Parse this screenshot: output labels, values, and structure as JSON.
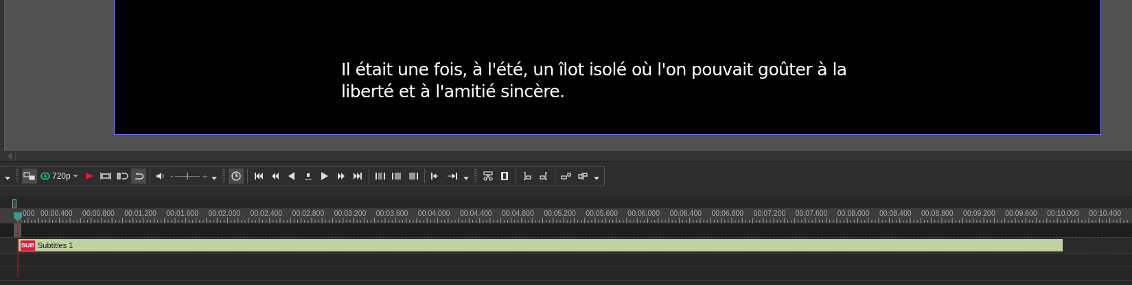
{
  "preview": {
    "subtitle_lines": [
      "Il était une fois, à l'été, un îlot isolé où l'on pouvait goûter à la",
      "liberté et à l'amitié sincère."
    ]
  },
  "toolbar": [
    {
      "kind": "caret"
    },
    {
      "kind": "grip"
    },
    {
      "kind": "monitor",
      "on": true
    },
    {
      "kind": "resolution",
      "label": "720p"
    },
    {
      "kind": "preview-play",
      "on": false
    },
    {
      "kind": "range",
      "on": false
    },
    {
      "kind": "loop-in",
      "on": false
    },
    {
      "kind": "loop",
      "on": true
    },
    {
      "kind": "sep"
    },
    {
      "kind": "speaker",
      "on": false
    },
    {
      "kind": "volume",
      "minus": "-",
      "plus": "+",
      "level": 0.5
    },
    {
      "kind": "caret"
    },
    {
      "kind": "grip"
    },
    {
      "kind": "clock",
      "on": true
    },
    {
      "kind": "sep"
    },
    {
      "kind": "skip-start",
      "on": false
    },
    {
      "kind": "rewind",
      "on": false
    },
    {
      "kind": "step-back",
      "on": false
    },
    {
      "kind": "marker",
      "on": false
    },
    {
      "kind": "play",
      "on": false
    },
    {
      "kind": "forward",
      "on": false
    },
    {
      "kind": "skip-end",
      "on": false
    },
    {
      "kind": "sep"
    },
    {
      "kind": "fade-both",
      "on": false
    },
    {
      "kind": "fade-in",
      "on": false
    },
    {
      "kind": "fade-out",
      "on": false
    },
    {
      "kind": "sep"
    },
    {
      "kind": "go-in",
      "on": false
    },
    {
      "kind": "go-out",
      "on": false
    },
    {
      "kind": "caret"
    },
    {
      "kind": "grip"
    },
    {
      "kind": "scissors",
      "on": false
    },
    {
      "kind": "split",
      "on": false
    },
    {
      "kind": "sep"
    },
    {
      "kind": "align-left",
      "on": false
    },
    {
      "kind": "align-right",
      "on": false
    },
    {
      "kind": "sep"
    },
    {
      "kind": "snap",
      "on": false
    },
    {
      "kind": "group",
      "on": false
    },
    {
      "kind": "caret"
    }
  ],
  "ruler": {
    "labels": [
      "000",
      "00:00.400",
      "00:00.800",
      "00:01.200",
      "00:01.600",
      "00:02.000",
      "00:02.400",
      "00:02.800",
      "00:03.200",
      "00:03.600",
      "00:04.000",
      "00:04.400",
      "00:04.800",
      "00:05.200",
      "00:05.600",
      "00:06.000",
      "00:06.400",
      "00:06.800",
      "00:07.200",
      "00:07.600",
      "00:08.000",
      "00:08.400",
      "00:08.800",
      "00:09.200",
      "00:09.600",
      "00:10.000",
      "00:10.400"
    ]
  },
  "tracks": [
    {
      "badge": "SUB",
      "name": "Subtitles 1"
    }
  ]
}
